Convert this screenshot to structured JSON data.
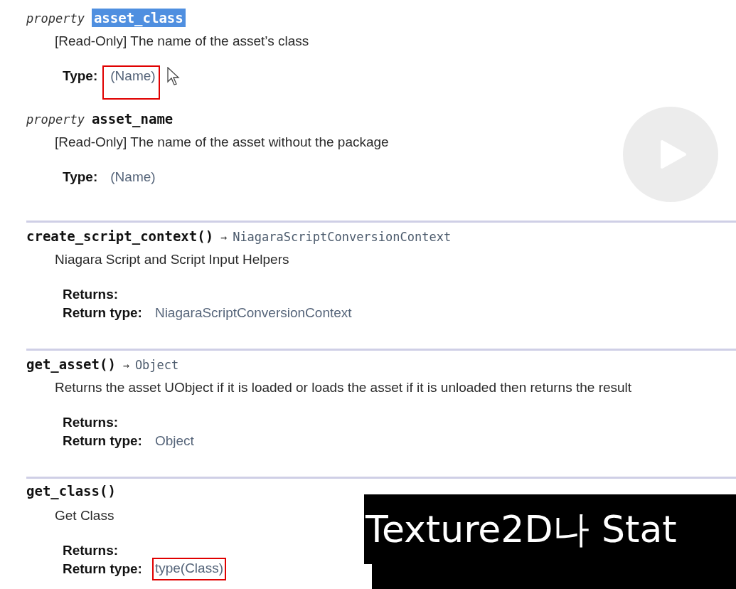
{
  "entries": [
    {
      "kind": "property",
      "keyword": "property",
      "name": "asset_class",
      "highlighted": true,
      "description": "[Read-Only] The name of the asset’s class",
      "fields": [
        {
          "label": "Type:",
          "value": "(Name)",
          "boxed": true,
          "pointer": true
        }
      ]
    },
    {
      "kind": "property",
      "keyword": "property",
      "name": "asset_name",
      "highlighted": false,
      "description": "[Read-Only] The name of the asset without the package",
      "fields": [
        {
          "label": "Type:",
          "value": "(Name)",
          "boxed": false,
          "pointer": false
        }
      ]
    },
    {
      "kind": "method",
      "name": "create_script_context()",
      "arrow": "→",
      "return_type": "NiagaraScriptConversionContext",
      "description": "Niagara Script and Script Input Helpers",
      "fields": [
        {
          "label": "Returns:"
        },
        {
          "label": "Return type:",
          "value": "NiagaraScriptConversionContext",
          "boxed": false,
          "pointer": false
        }
      ]
    },
    {
      "kind": "method",
      "name": "get_asset()",
      "arrow": "→",
      "return_type": "Object",
      "description": "Returns the asset UObject if it is loaded or loads the asset if it is unloaded then returns the result",
      "fields": [
        {
          "label": "Returns:"
        },
        {
          "label": "Return type:",
          "value": "Object",
          "boxed": false,
          "pointer": false
        }
      ]
    },
    {
      "kind": "method",
      "name": "get_class()",
      "description": "Get Class",
      "fields": [
        {
          "label": "Returns:"
        },
        {
          "label": "Return type:",
          "value": "type(Class)",
          "boxed": true,
          "pointer": false
        }
      ]
    }
  ],
  "overlays": {
    "play_button": true,
    "subtitle": "Texture2D나 Stat",
    "subtitle_next_line": true
  }
}
